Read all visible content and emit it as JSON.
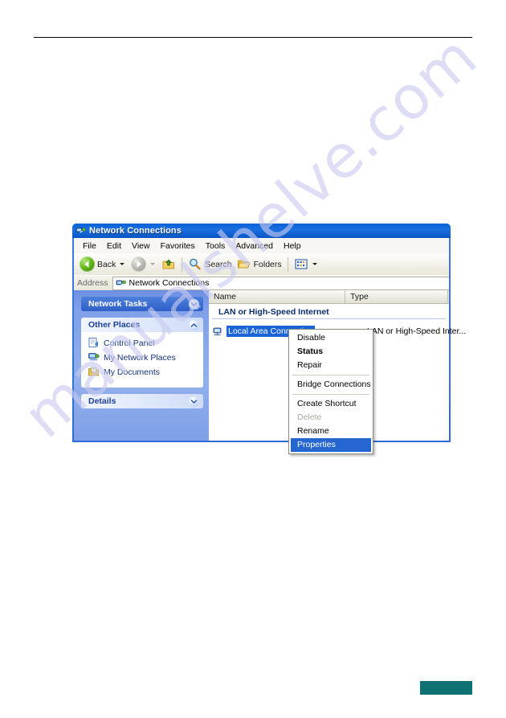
{
  "document": {
    "rule": "horizontal-rule",
    "footer_block_color": "#0f7272"
  },
  "watermark": {
    "text": "manualshelve.com",
    "color": "#c9cbf0"
  },
  "window": {
    "title": "Network Connections",
    "title_icon": "network-connections-icon",
    "menu": [
      {
        "label": "File"
      },
      {
        "label": "Edit"
      },
      {
        "label": "View"
      },
      {
        "label": "Favorites"
      },
      {
        "label": "Tools"
      },
      {
        "label": "Advanced"
      },
      {
        "label": "Help"
      }
    ],
    "toolbar": {
      "back_label": "Back",
      "back_icon": "back-arrow-icon",
      "forward_icon": "forward-arrow-icon",
      "up_icon": "up-folder-icon",
      "search_label": "Search",
      "search_icon": "search-icon",
      "folders_label": "Folders",
      "folders_icon": "folders-icon",
      "views_icon": "views-icon"
    },
    "address": {
      "label": "Address",
      "icon": "network-connections-icon",
      "value": "Network Connections"
    },
    "sidebar": {
      "panels": [
        {
          "title": "Network Tasks",
          "state": "collapsed",
          "chevron": "chevron-down-icon",
          "items": []
        },
        {
          "title": "Other Places",
          "state": "expanded",
          "chevron": "chevron-up-icon",
          "items": [
            {
              "label": "Control Panel",
              "icon": "control-panel-icon"
            },
            {
              "label": "My Network Places",
              "icon": "my-network-places-icon"
            },
            {
              "label": "My Documents",
              "icon": "my-documents-icon"
            }
          ]
        },
        {
          "title": "Details",
          "state": "collapsed",
          "chevron": "chevron-down-icon",
          "items": []
        }
      ]
    },
    "list": {
      "columns": [
        {
          "label": "Name"
        },
        {
          "label": "Type"
        }
      ],
      "group_header": "LAN or High-Speed Internet",
      "rows": [
        {
          "name": "Local Area Connection",
          "type": "LAN or High-Speed Inter...",
          "icon": "network-adapter-icon",
          "selected": true
        }
      ]
    }
  },
  "context_menu": {
    "items": [
      {
        "label": "Disable",
        "style": "normal"
      },
      {
        "label": "Status",
        "style": "bold"
      },
      {
        "label": "Repair",
        "style": "normal"
      },
      {
        "separator": true
      },
      {
        "label": "Bridge Connections",
        "style": "normal"
      },
      {
        "separator": true
      },
      {
        "label": "Create Shortcut",
        "style": "normal"
      },
      {
        "label": "Delete",
        "style": "disabled"
      },
      {
        "label": "Rename",
        "style": "normal"
      },
      {
        "label": "Properties",
        "style": "selected"
      }
    ]
  }
}
